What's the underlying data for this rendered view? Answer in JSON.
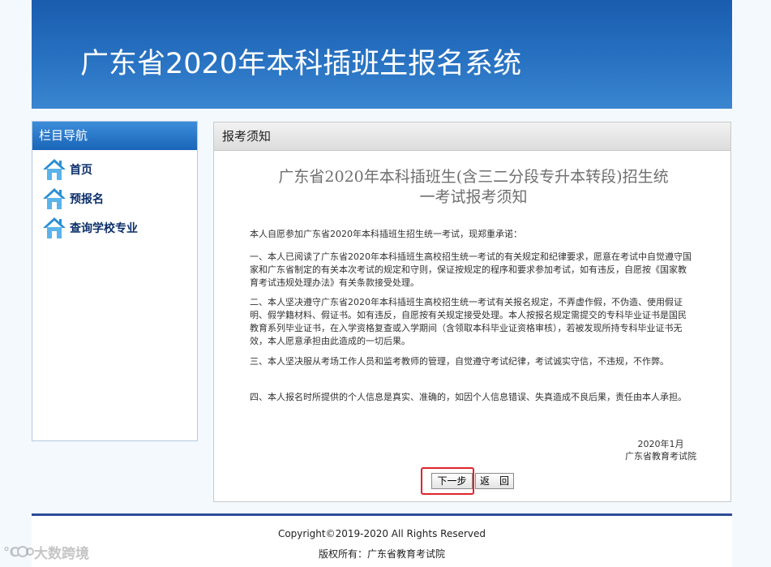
{
  "banner": {
    "title": "广东省2020年本科插班生报名系统"
  },
  "sidebar": {
    "header": "栏目导航",
    "items": [
      {
        "label": "首页",
        "icon": "home-icon"
      },
      {
        "label": "预报名",
        "icon": "home-icon"
      },
      {
        "label": "查询学校专业",
        "icon": "home-icon"
      }
    ]
  },
  "content": {
    "header": "报考须知",
    "title_line1": "广东省2020年本科插班生(含三二分段专升本转段)招生统",
    "title_line2": "一考试报考须知",
    "paragraphs": [
      "本人自愿参加广东省2020年本科插班生招生统一考试，现郑重承诺：",
      "一、本人已阅读了广东省2020年本科插班生高校招生统一考试的有关规定和纪律要求，愿意在考试中自觉遵守国家和广东省制定的有关本次考试的规定和守则，保证按规定的程序和要求参加考试，如有违反，自愿按《国家教育考试违规处理办法》有关条款接受处理。",
      "二、本人坚决遵守广东省2020年本科插班生高校招生统一考试有关报名规定，不弄虚作假，不伪造、使用假证明、假学籍材料、假证书。如有违反，自愿按有关规定接受处理。本人按报名规定需提交的专科毕业证书是国民教育系列毕业证书，在入学资格复查或入学期间（含领取本科毕业证资格审核），若被发现所持专科毕业证书无效，本人愿意承担由此造成的一切后果。",
      "三、本人坚决服从考场工作人员和监考教师的管理，自觉遵守考试纪律，考试诚实守信，不违规，不作弊。",
      "四、本人报名时所提供的个人信息是真实、准确的，如因个人信息错误、失真造成不良后果，责任由本人承担。"
    ],
    "sign_date": "2020年1月",
    "sign_org": "广东省教育考试院",
    "next_button": "下一步",
    "back_button": "返　回"
  },
  "footer": {
    "copyright": "Copyright©2019-2020 All Rights Reserved",
    "owner": "版权所有：广东省教育考试院"
  },
  "watermark": {
    "text": "大数跨境"
  },
  "colors": {
    "banner": "#2872c2",
    "nav_text": "#0b2f6b",
    "highlight": "#e0242b"
  }
}
